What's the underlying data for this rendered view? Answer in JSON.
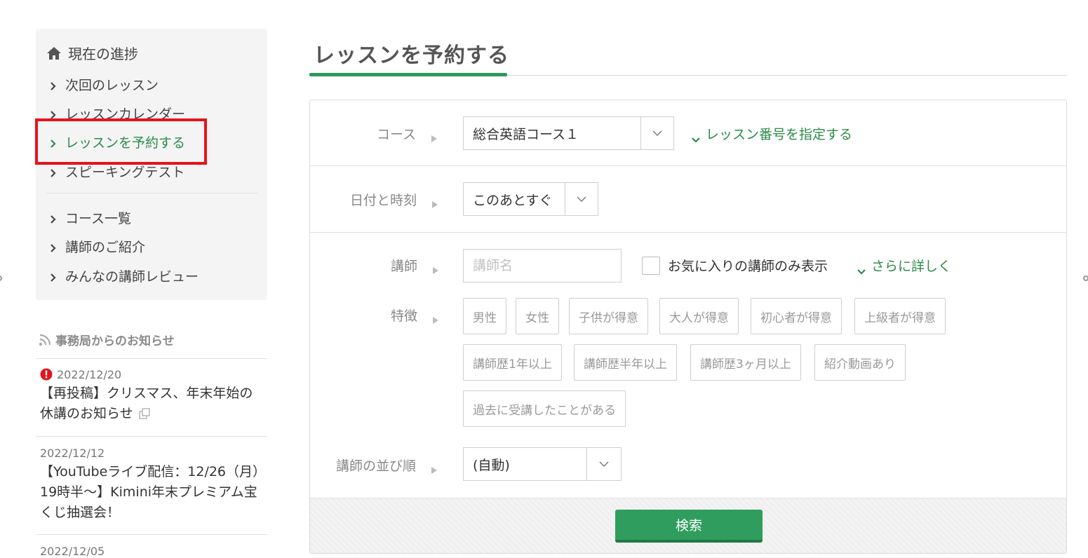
{
  "sidebar": {
    "title": "現在の進捗",
    "items": [
      {
        "label": "次回のレッスン"
      },
      {
        "label": "レッスンカレンダー"
      },
      {
        "label": "レッスンを予約する"
      },
      {
        "label": "スピーキングテスト"
      },
      {
        "label": "コース一覧"
      },
      {
        "label": "講師のご紹介"
      },
      {
        "label": "みんなの講師レビュー"
      }
    ],
    "active_item": "レッスンを予約する"
  },
  "news": {
    "heading": "事務局からのお知らせ",
    "items": [
      {
        "date": "2022/12/20",
        "title": "【再投稿】クリスマス、年末年始の休講のお知らせ"
      },
      {
        "date": "2022/12/12",
        "title": "【YouTubeライブ配信：12/26（月）19時半〜】Kimini年末プレミアム宝くじ抽選会！"
      },
      {
        "date": "2022/12/05"
      }
    ]
  },
  "main": {
    "title": "レッスンを予約する",
    "form": {
      "course_label": "コース",
      "course_value": "総合英語コース１",
      "lesson_number_link": "レッスン番号を指定する",
      "datetime_label": "日付と時刻",
      "datetime_value": "このあとすぐ",
      "teacher_label": "講師",
      "teacher_placeholder": "講師名",
      "favorites_only_label": "お気に入りの講師のみ表示",
      "more_details_link": "さらに詳しく",
      "features_label": "特徴",
      "feature_tags": [
        "男性",
        "女性",
        "子供が得意",
        "大人が得意",
        "初心者が得意",
        "上級者が得意",
        "講師歴1年以上",
        "講師歴半年以上",
        "講師歴3ヶ月以上",
        "紹介動画あり",
        "過去に受講したことがある"
      ],
      "sort_label": "講師の並び順",
      "sort_value": "(自動)",
      "search_button": "検索"
    }
  },
  "colors": {
    "accent_green": "#2e9a5a",
    "highlight_red": "#e8121a"
  }
}
